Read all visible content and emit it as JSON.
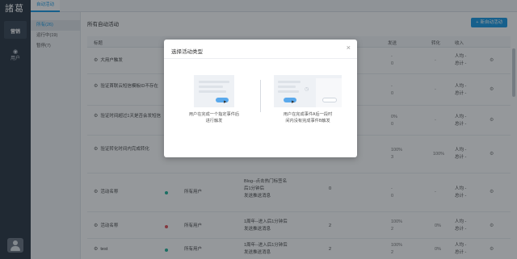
{
  "nav": {
    "logo": "諸葛",
    "items": [
      {
        "label": "营销"
      },
      {
        "label": "用户"
      }
    ]
  },
  "topbar": {
    "tab": "自动活动"
  },
  "sidebar": {
    "items": [
      {
        "label": "所有(26)"
      },
      {
        "label": "运行中(19)"
      },
      {
        "label": "暂停(7)"
      }
    ]
  },
  "main": {
    "title": "所有自动活动",
    "new_button": "新自动活动",
    "columns": [
      "标题",
      "发送",
      "转化",
      "收入"
    ],
    "rows": [
      {
        "title": "大用户触发",
        "send": [
          "-",
          "0"
        ],
        "conv": "-",
        "income": [
          "人均 -",
          "总计 -"
        ]
      },
      {
        "title": "验证首联云短信模板ID不存在",
        "send": [
          "-",
          "0"
        ],
        "conv": "-",
        "income": [
          "人均 -",
          "总计 -"
        ]
      },
      {
        "title": "验证时间超过1天是否会发短信",
        "send": [
          "0%",
          "0"
        ],
        "conv": "-",
        "income": [
          "人均 -",
          "总计 -"
        ]
      },
      {
        "title": "验证转化时间内完成转化",
        "send": [
          "100%",
          "3"
        ],
        "conv": "100%",
        "income": [
          "人均 -",
          "总计 -"
        ]
      },
      {
        "title": "活动名称",
        "audience": "所有用户",
        "trigger": [
          "Blog--点击热门标签名",
          "后1分钟后",
          "发送推送消息"
        ],
        "count": "0",
        "send": [
          "-",
          "0"
        ],
        "conv": "-",
        "income": [
          "人均 -",
          "总计 -"
        ]
      },
      {
        "title": "活动名称",
        "audience": "所有用户",
        "trigger": [
          "1周年--进入后1分钟后",
          "发送推送消息"
        ],
        "count": "2",
        "send": [
          "100%",
          "2"
        ],
        "conv": "0%",
        "income": [
          "人均 -",
          "总计 -"
        ]
      },
      {
        "title": "test",
        "audience": "所有用户",
        "trigger": [
          "1周年--进入后1分钟后",
          "发送推送消息"
        ],
        "count": "2",
        "send": [
          "100%",
          "2"
        ],
        "conv": "0%",
        "income": [
          "人均 -",
          "总计 -"
        ]
      }
    ]
  },
  "modal": {
    "title": "选择活动类型",
    "close": "×",
    "options": [
      {
        "text": [
          "用户在完成一个指定事件后",
          "进行触发"
        ]
      },
      {
        "text": [
          "用户在完成事件A后一段时",
          "间内没有完成事件B触发"
        ]
      }
    ]
  },
  "colors": {
    "accent": "#1a9ae3",
    "nav_bg": "#2b3542",
    "status_on": "#21b39a",
    "status_off": "#e0525a"
  }
}
